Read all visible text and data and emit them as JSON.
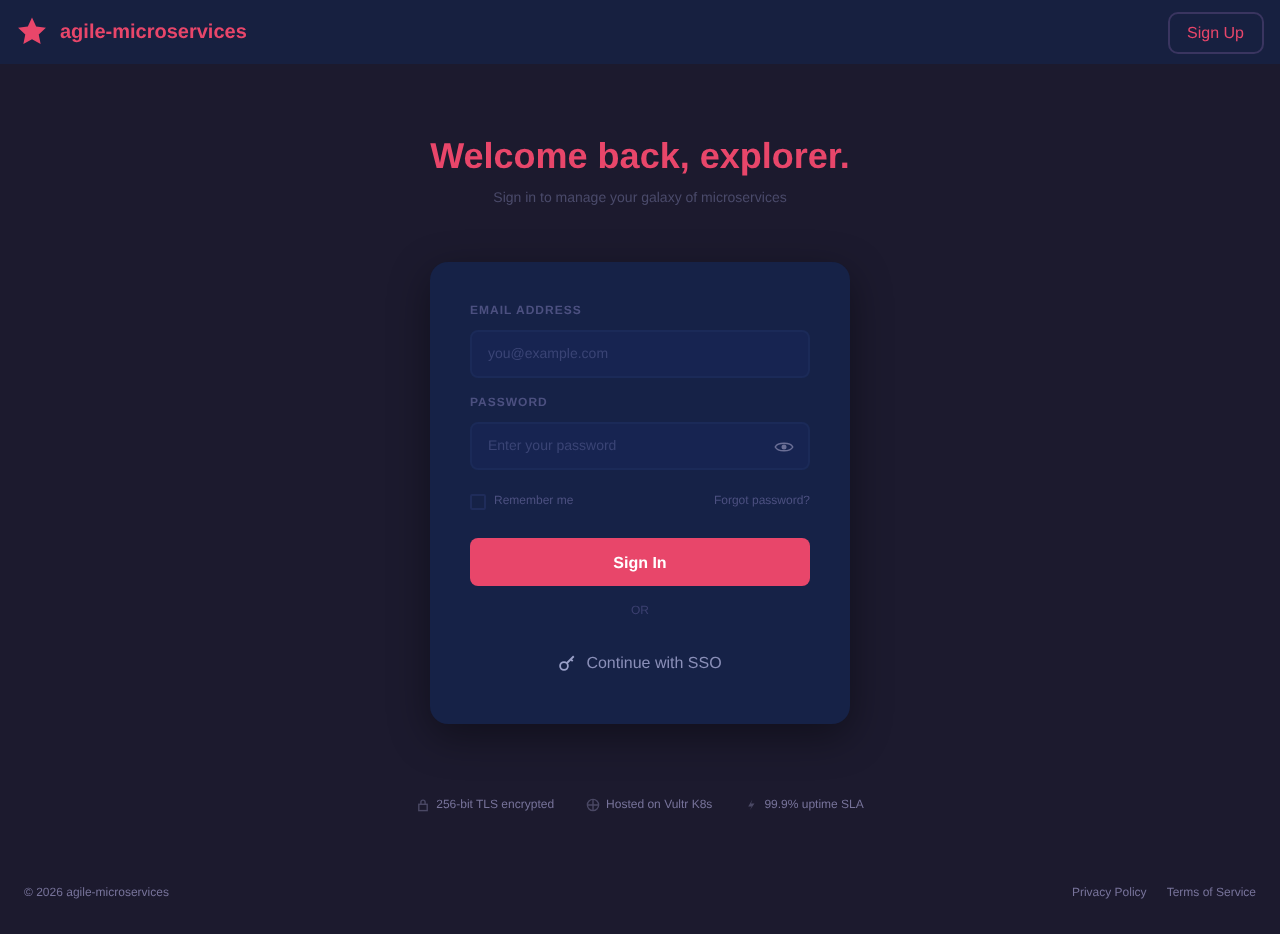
{
  "header": {
    "brand": "agile-microservices",
    "signup": "Sign Up"
  },
  "hero": {
    "title": "Welcome back, explorer.",
    "subtitle": "Sign in to manage your galaxy of microservices"
  },
  "form": {
    "email": {
      "label": "EMAIL ADDRESS",
      "placeholder": "you@example.com"
    },
    "password": {
      "label": "PASSWORD",
      "placeholder": "Enter your password"
    },
    "remember": {
      "label": "Remember me",
      "checked": false
    },
    "forgot": "Forgot password?",
    "submit": "Sign In",
    "divider": "OR",
    "sso": "Continue with SSO"
  },
  "trust": [
    {
      "kind": "lock",
      "text": "256-bit TLS encrypted"
    },
    {
      "kind": "globe",
      "text": "Hosted on Vultr K8s"
    },
    {
      "kind": "bolt",
      "text": "99.9% uptime SLA"
    }
  ],
  "footer": {
    "copyright": "© 2026 agile-microservices",
    "links": [
      "Privacy Policy",
      "Terms of Service"
    ]
  }
}
